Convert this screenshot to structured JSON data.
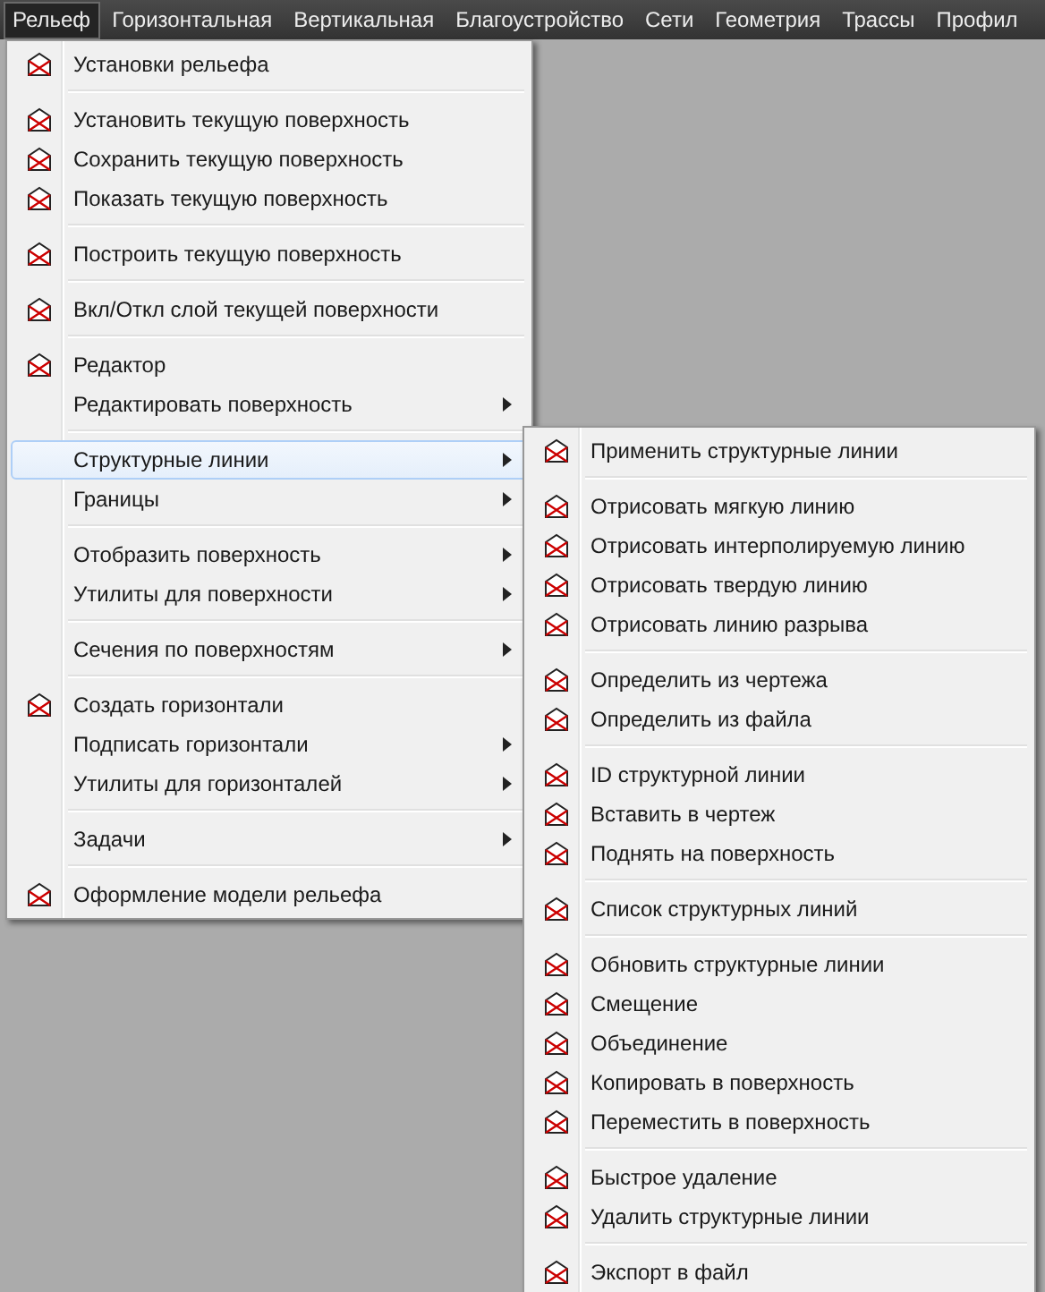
{
  "menu_bar": [
    {
      "label": "Рельеф",
      "selected": true
    },
    {
      "label": "Горизонтальная",
      "selected": false
    },
    {
      "label": "Вертикальная",
      "selected": false
    },
    {
      "label": "Благоустройство",
      "selected": false
    },
    {
      "label": "Сети",
      "selected": false
    },
    {
      "label": "Геометрия",
      "selected": false
    },
    {
      "label": "Трассы",
      "selected": false
    },
    {
      "label": "Профил",
      "selected": false
    }
  ],
  "menu": {
    "groups": [
      [
        {
          "label": "Установки рельефа",
          "icon": true,
          "submenu": false,
          "selected": false
        }
      ],
      [
        {
          "label": "Установить текущую поверхность",
          "icon": true,
          "submenu": false,
          "selected": false
        },
        {
          "label": "Сохранить текущую поверхность",
          "icon": true,
          "submenu": false,
          "selected": false
        },
        {
          "label": "Показать текущую поверхность",
          "icon": true,
          "submenu": false,
          "selected": false
        }
      ],
      [
        {
          "label": "Построить текущую поверхность",
          "icon": true,
          "submenu": false,
          "selected": false
        }
      ],
      [
        {
          "label": "Вкл/Откл слой текущей поверхности",
          "icon": true,
          "submenu": false,
          "selected": false
        }
      ],
      [
        {
          "label": "Редактор",
          "icon": true,
          "submenu": false,
          "selected": false
        },
        {
          "label": "Редактировать поверхность",
          "icon": false,
          "submenu": true,
          "selected": false
        }
      ],
      [
        {
          "label": "Структурные линии",
          "icon": false,
          "submenu": true,
          "selected": true
        },
        {
          "label": "Границы",
          "icon": false,
          "submenu": true,
          "selected": false
        }
      ],
      [
        {
          "label": "Отобразить поверхность",
          "icon": false,
          "submenu": true,
          "selected": false
        },
        {
          "label": "Утилиты для поверхности",
          "icon": false,
          "submenu": true,
          "selected": false
        }
      ],
      [
        {
          "label": "Сечения по поверхностям",
          "icon": false,
          "submenu": true,
          "selected": false
        }
      ],
      [
        {
          "label": "Создать горизонтали",
          "icon": true,
          "submenu": false,
          "selected": false
        },
        {
          "label": "Подписать горизонтали",
          "icon": false,
          "submenu": true,
          "selected": false
        },
        {
          "label": "Утилиты для горизонталей",
          "icon": false,
          "submenu": true,
          "selected": false
        }
      ],
      [
        {
          "label": "Задачи",
          "icon": false,
          "submenu": true,
          "selected": false
        }
      ],
      [
        {
          "label": "Оформление модели рельефа",
          "icon": true,
          "submenu": false,
          "selected": false
        }
      ]
    ]
  },
  "submenu": {
    "groups": [
      [
        {
          "label": "Применить структурные линии",
          "icon": true,
          "submenu": false,
          "selected": false
        }
      ],
      [
        {
          "label": "Отрисовать мягкую линию",
          "icon": true,
          "submenu": false,
          "selected": false
        },
        {
          "label": "Отрисовать интерполируемую линию",
          "icon": true,
          "submenu": false,
          "selected": false
        },
        {
          "label": "Отрисовать твердую линию",
          "icon": true,
          "submenu": false,
          "selected": false
        },
        {
          "label": "Отрисовать линию разрыва",
          "icon": true,
          "submenu": false,
          "selected": false
        }
      ],
      [
        {
          "label": "Определить из чертежа",
          "icon": true,
          "submenu": false,
          "selected": false
        },
        {
          "label": "Определить из файла",
          "icon": true,
          "submenu": false,
          "selected": false
        }
      ],
      [
        {
          "label": "ID структурной линии",
          "icon": true,
          "submenu": false,
          "selected": false
        },
        {
          "label": "Вставить в чертеж",
          "icon": true,
          "submenu": false,
          "selected": false
        },
        {
          "label": "Поднять на поверхность",
          "icon": true,
          "submenu": false,
          "selected": false
        }
      ],
      [
        {
          "label": "Список структурных линий",
          "icon": true,
          "submenu": false,
          "selected": false
        }
      ],
      [
        {
          "label": "Обновить структурные линии",
          "icon": true,
          "submenu": false,
          "selected": false
        },
        {
          "label": "Смещение",
          "icon": true,
          "submenu": false,
          "selected": false
        },
        {
          "label": "Объединение",
          "icon": true,
          "submenu": false,
          "selected": false
        },
        {
          "label": "Копировать в поверхность",
          "icon": true,
          "submenu": false,
          "selected": false
        },
        {
          "label": "Переместить в поверхность",
          "icon": true,
          "submenu": false,
          "selected": false
        }
      ],
      [
        {
          "label": "Быстрое удаление",
          "icon": true,
          "submenu": false,
          "selected": false
        },
        {
          "label": "Удалить структурные линии",
          "icon": true,
          "submenu": false,
          "selected": false
        }
      ],
      [
        {
          "label": "Экспорт в файл",
          "icon": true,
          "submenu": false,
          "selected": false
        }
      ]
    ]
  }
}
